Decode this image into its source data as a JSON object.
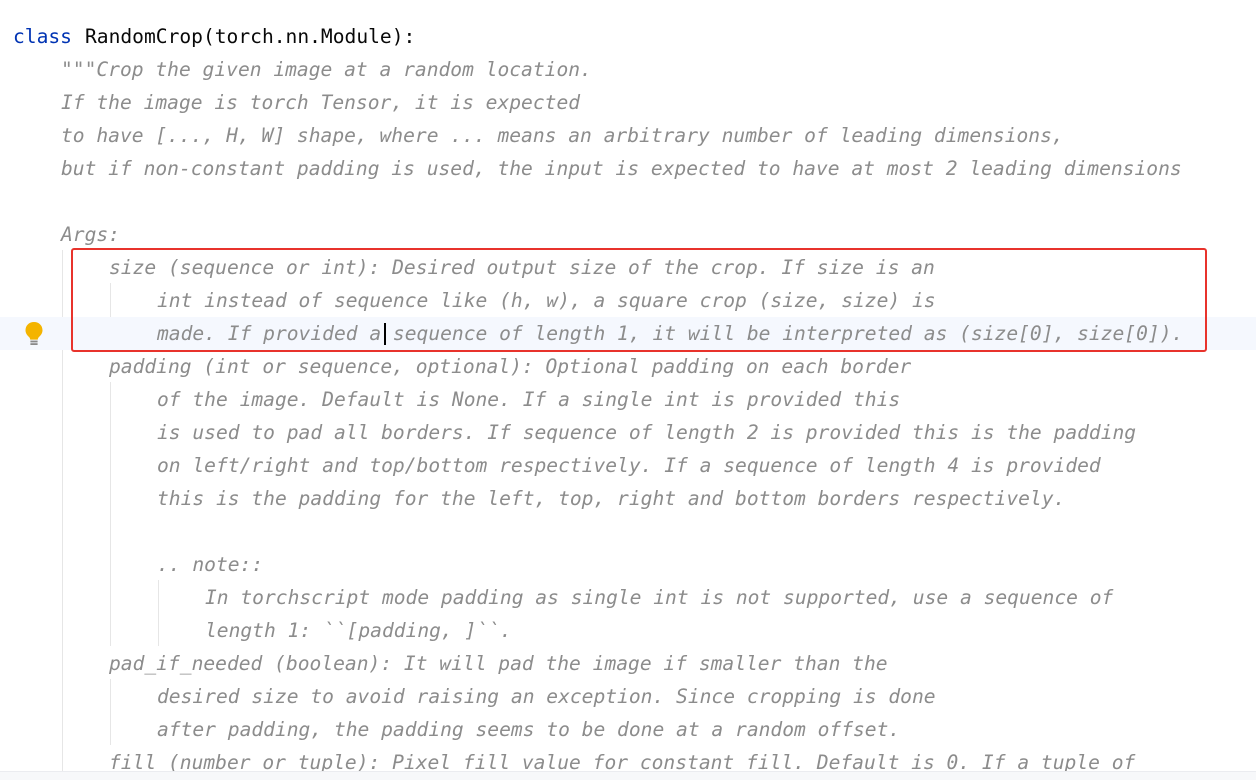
{
  "class_line": {
    "keyword": "class",
    "rest": "RandomCrop(torch.nn.Module):"
  },
  "lines": [
    {
      "text": "\"\"\"Crop the given image at a random location."
    },
    {
      "text": "If the image is torch Tensor, it is expected"
    },
    {
      "text": "to have [..., H, W] shape, where ... means an arbitrary number of leading dimensions,"
    },
    {
      "text": "but if non-constant padding is used, the input is expected to have at most 2 leading dimensions"
    },
    {
      "text": ""
    },
    {
      "text": "Args:"
    },
    {
      "text": "size (sequence or int): Desired output size of the crop. If size is an"
    },
    {
      "text": "int instead of sequence like (h, w), a square crop (size, size) is"
    },
    {
      "text": "made. If provided a sequence of length 1, it will be interpreted as (size[0], size[0])."
    },
    {
      "text": "padding (int or sequence, optional): Optional padding on each border"
    },
    {
      "text": "of the image. Default is None. If a single int is provided this"
    },
    {
      "text": "is used to pad all borders. If sequence of length 2 is provided this is the padding"
    },
    {
      "text": "on left/right and top/bottom respectively. If a sequence of length 4 is provided"
    },
    {
      "text": "this is the padding for the left, top, right and bottom borders respectively."
    },
    {
      "text": ""
    },
    {
      "text": ".. note::"
    },
    {
      "text": "In torchscript mode padding as single int is not supported, use a sequence of"
    },
    {
      "text": "length 1: ``[padding, ]``."
    },
    {
      "text": "pad_if_needed (boolean): It will pad the image if smaller than the"
    },
    {
      "text": "desired size to avoid raising an exception. Since cropping is done"
    },
    {
      "text": "after padding, the padding seems to be done at a random offset."
    },
    {
      "text": "fill (number or tuple): Pixel fill value for constant fill. Default is 0. If a tuple of"
    }
  ],
  "gutter": {
    "intention_icon": "lightbulb-icon"
  },
  "colors": {
    "keyword": "#0033b3",
    "docstring": "#8c8c8c",
    "highlight_border": "#e8332c",
    "current_line": "#f5f8fe"
  }
}
